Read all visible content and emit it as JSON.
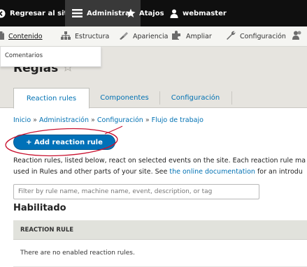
{
  "toolbar": {
    "back_label": "Regresar al sitio",
    "admin_label": "Administrar",
    "shortcuts_label": "Atajos",
    "user_label": "webmaster"
  },
  "tray": {
    "content_label": "Contenido",
    "structure_label": "Estructura",
    "appearance_label": "Apariencia",
    "extend_label": "Ampliar",
    "config_label": "Configuración"
  },
  "dropdown": {
    "item": "Comentarios"
  },
  "page": {
    "title": "Reglas"
  },
  "tabs": [
    {
      "label": "Reaction rules",
      "active": true
    },
    {
      "label": "Componentes",
      "active": false
    },
    {
      "label": "Configuración",
      "active": false
    }
  ],
  "breadcrumb": {
    "items": [
      "Inicio",
      "Administración",
      "Configuración",
      "Flujo de trabajo"
    ],
    "separator": " » "
  },
  "add_button": {
    "label": "+ Add reaction rule"
  },
  "description": {
    "line1": "Reaction rules, listed below, react on selected events on the site. Each reaction rule ma",
    "line2_prefix": "used in Rules and other parts of your site. See ",
    "line2_link": "the online documentation",
    "line2_suffix": " for an introdu"
  },
  "filter": {
    "placeholder": "Filter by rule name, machine name, event, description, or tag"
  },
  "section": {
    "heading": "Habilitado"
  },
  "table": {
    "column_header": "REACTION RULE",
    "empty_message": "There are no enabled reaction rules."
  },
  "colors": {
    "toolbar_bg": "#0f0f0f",
    "link": "#0071b3",
    "button": "#0071b8",
    "annotation": "#c8102e"
  }
}
